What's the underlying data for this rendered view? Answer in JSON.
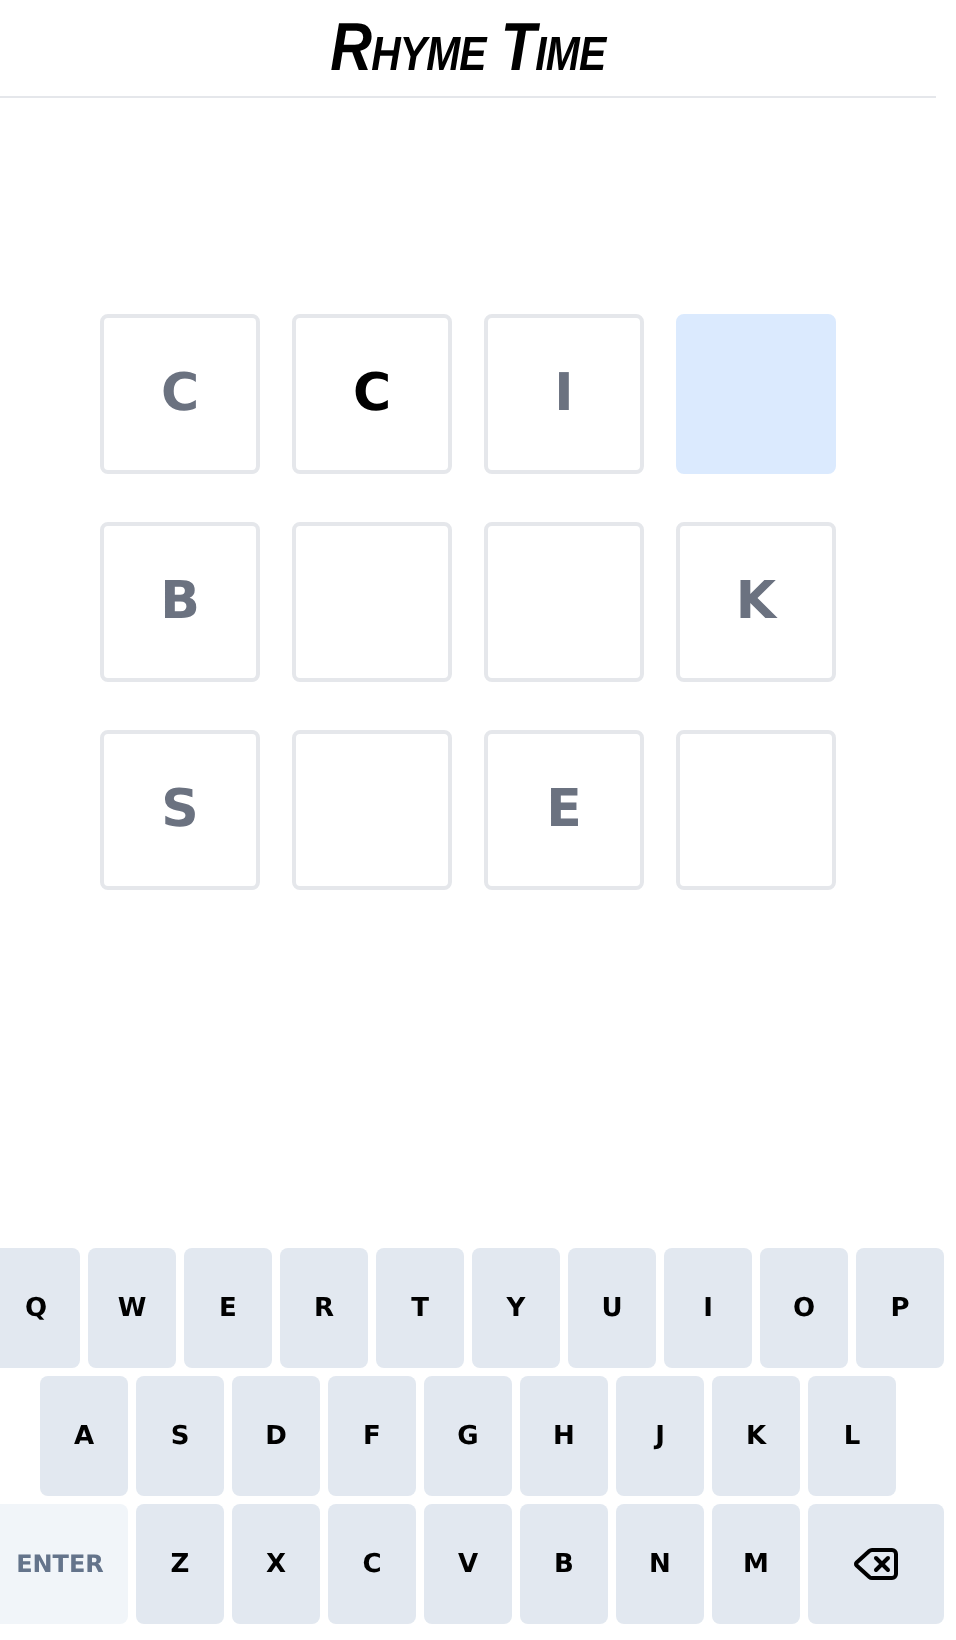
{
  "title": "Rhyme Time",
  "grid": [
    [
      {
        "letter": "C",
        "kind": "given",
        "selected": false
      },
      {
        "letter": "C",
        "kind": "typed",
        "selected": false
      },
      {
        "letter": "I",
        "kind": "given",
        "selected": false
      },
      {
        "kind": "empty",
        "selected": true
      }
    ],
    [
      {
        "letter": "B",
        "kind": "given",
        "selected": false
      },
      {
        "kind": "empty",
        "selected": false
      },
      {
        "kind": "empty",
        "selected": false
      },
      {
        "letter": "K",
        "kind": "given",
        "selected": false
      }
    ],
    [
      {
        "letter": "S",
        "kind": "given",
        "selected": false
      },
      {
        "kind": "empty",
        "selected": false
      },
      {
        "letter": "E",
        "kind": "given",
        "selected": false
      },
      {
        "kind": "empty",
        "selected": false
      }
    ]
  ],
  "keyboard": [
    [
      {
        "kind": "letter",
        "label": "Q"
      },
      {
        "kind": "letter",
        "label": "W"
      },
      {
        "kind": "letter",
        "label": "E"
      },
      {
        "kind": "letter",
        "label": "R"
      },
      {
        "kind": "letter",
        "label": "T"
      },
      {
        "kind": "letter",
        "label": "Y"
      },
      {
        "kind": "letter",
        "label": "U"
      },
      {
        "kind": "letter",
        "label": "I"
      },
      {
        "kind": "letter",
        "label": "O"
      },
      {
        "kind": "letter",
        "label": "P"
      }
    ],
    [
      {
        "kind": "letter",
        "label": "A"
      },
      {
        "kind": "letter",
        "label": "S"
      },
      {
        "kind": "letter",
        "label": "D"
      },
      {
        "kind": "letter",
        "label": "F"
      },
      {
        "kind": "letter",
        "label": "G"
      },
      {
        "kind": "letter",
        "label": "H"
      },
      {
        "kind": "letter",
        "label": "J"
      },
      {
        "kind": "letter",
        "label": "K"
      },
      {
        "kind": "letter",
        "label": "L"
      }
    ],
    [
      {
        "kind": "enter",
        "label": "ENTER",
        "disabled": true
      },
      {
        "kind": "letter",
        "label": "Z"
      },
      {
        "kind": "letter",
        "label": "X"
      },
      {
        "kind": "letter",
        "label": "C"
      },
      {
        "kind": "letter",
        "label": "V"
      },
      {
        "kind": "letter",
        "label": "B"
      },
      {
        "kind": "letter",
        "label": "N"
      },
      {
        "kind": "letter",
        "label": "M"
      },
      {
        "kind": "backspace"
      }
    ]
  ]
}
